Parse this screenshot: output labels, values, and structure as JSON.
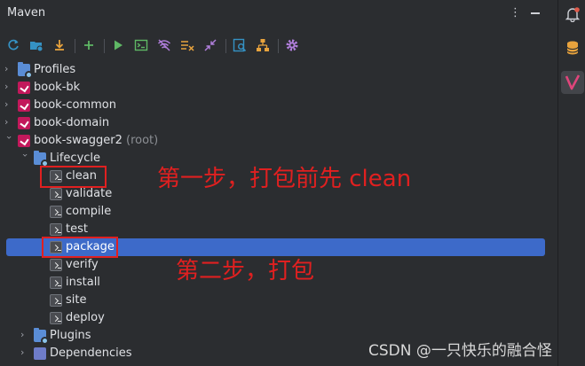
{
  "panel": {
    "title": "Maven",
    "menu_glyph": "⋮"
  },
  "toolbar": {
    "icons": [
      "reload-icon",
      "add-maven-projects-icon",
      "download-icon",
      "add-icon",
      "run-icon",
      "execute-goal-icon",
      "toggle-offline-icon",
      "skip-tests-icon",
      "collapse-icon",
      "show-dependencies-icon",
      "diagram-icon",
      "settings-icon"
    ],
    "accent_green": "#5fb865",
    "accent_blue": "#3592c4",
    "accent_orange": "#e8a33d",
    "accent_purple": "#b07edb"
  },
  "tree": {
    "projects": [
      {
        "label": "Profiles",
        "type": "profiles"
      },
      {
        "label": "book-bk",
        "type": "module"
      },
      {
        "label": "book-common",
        "type": "module"
      },
      {
        "label": "book-domain",
        "type": "module"
      },
      {
        "label": "book-swagger2",
        "suffix": "(root)",
        "type": "module"
      }
    ],
    "lifecycle_label": "Lifecycle",
    "goals": [
      "clean",
      "validate",
      "compile",
      "test",
      "package",
      "verify",
      "install",
      "site",
      "deploy"
    ],
    "selected_goal": "package",
    "plugins_label": "Plugins",
    "dependencies_label": "Dependencies"
  },
  "annotations": {
    "step1": "第一步，打包前先 clean",
    "step2": "第二步，打包",
    "color": "#e02020"
  },
  "watermark": "CSDN @一只快乐的融合怪",
  "right_strip": {
    "icons": [
      "notifications-icon",
      "database-icon",
      "maven-icon"
    ],
    "active": "maven-icon"
  },
  "colors": {
    "background": "#2b2d30",
    "selection": "#3d6ac9",
    "text": "#dfe1e5",
    "muted": "#8c8f94"
  }
}
